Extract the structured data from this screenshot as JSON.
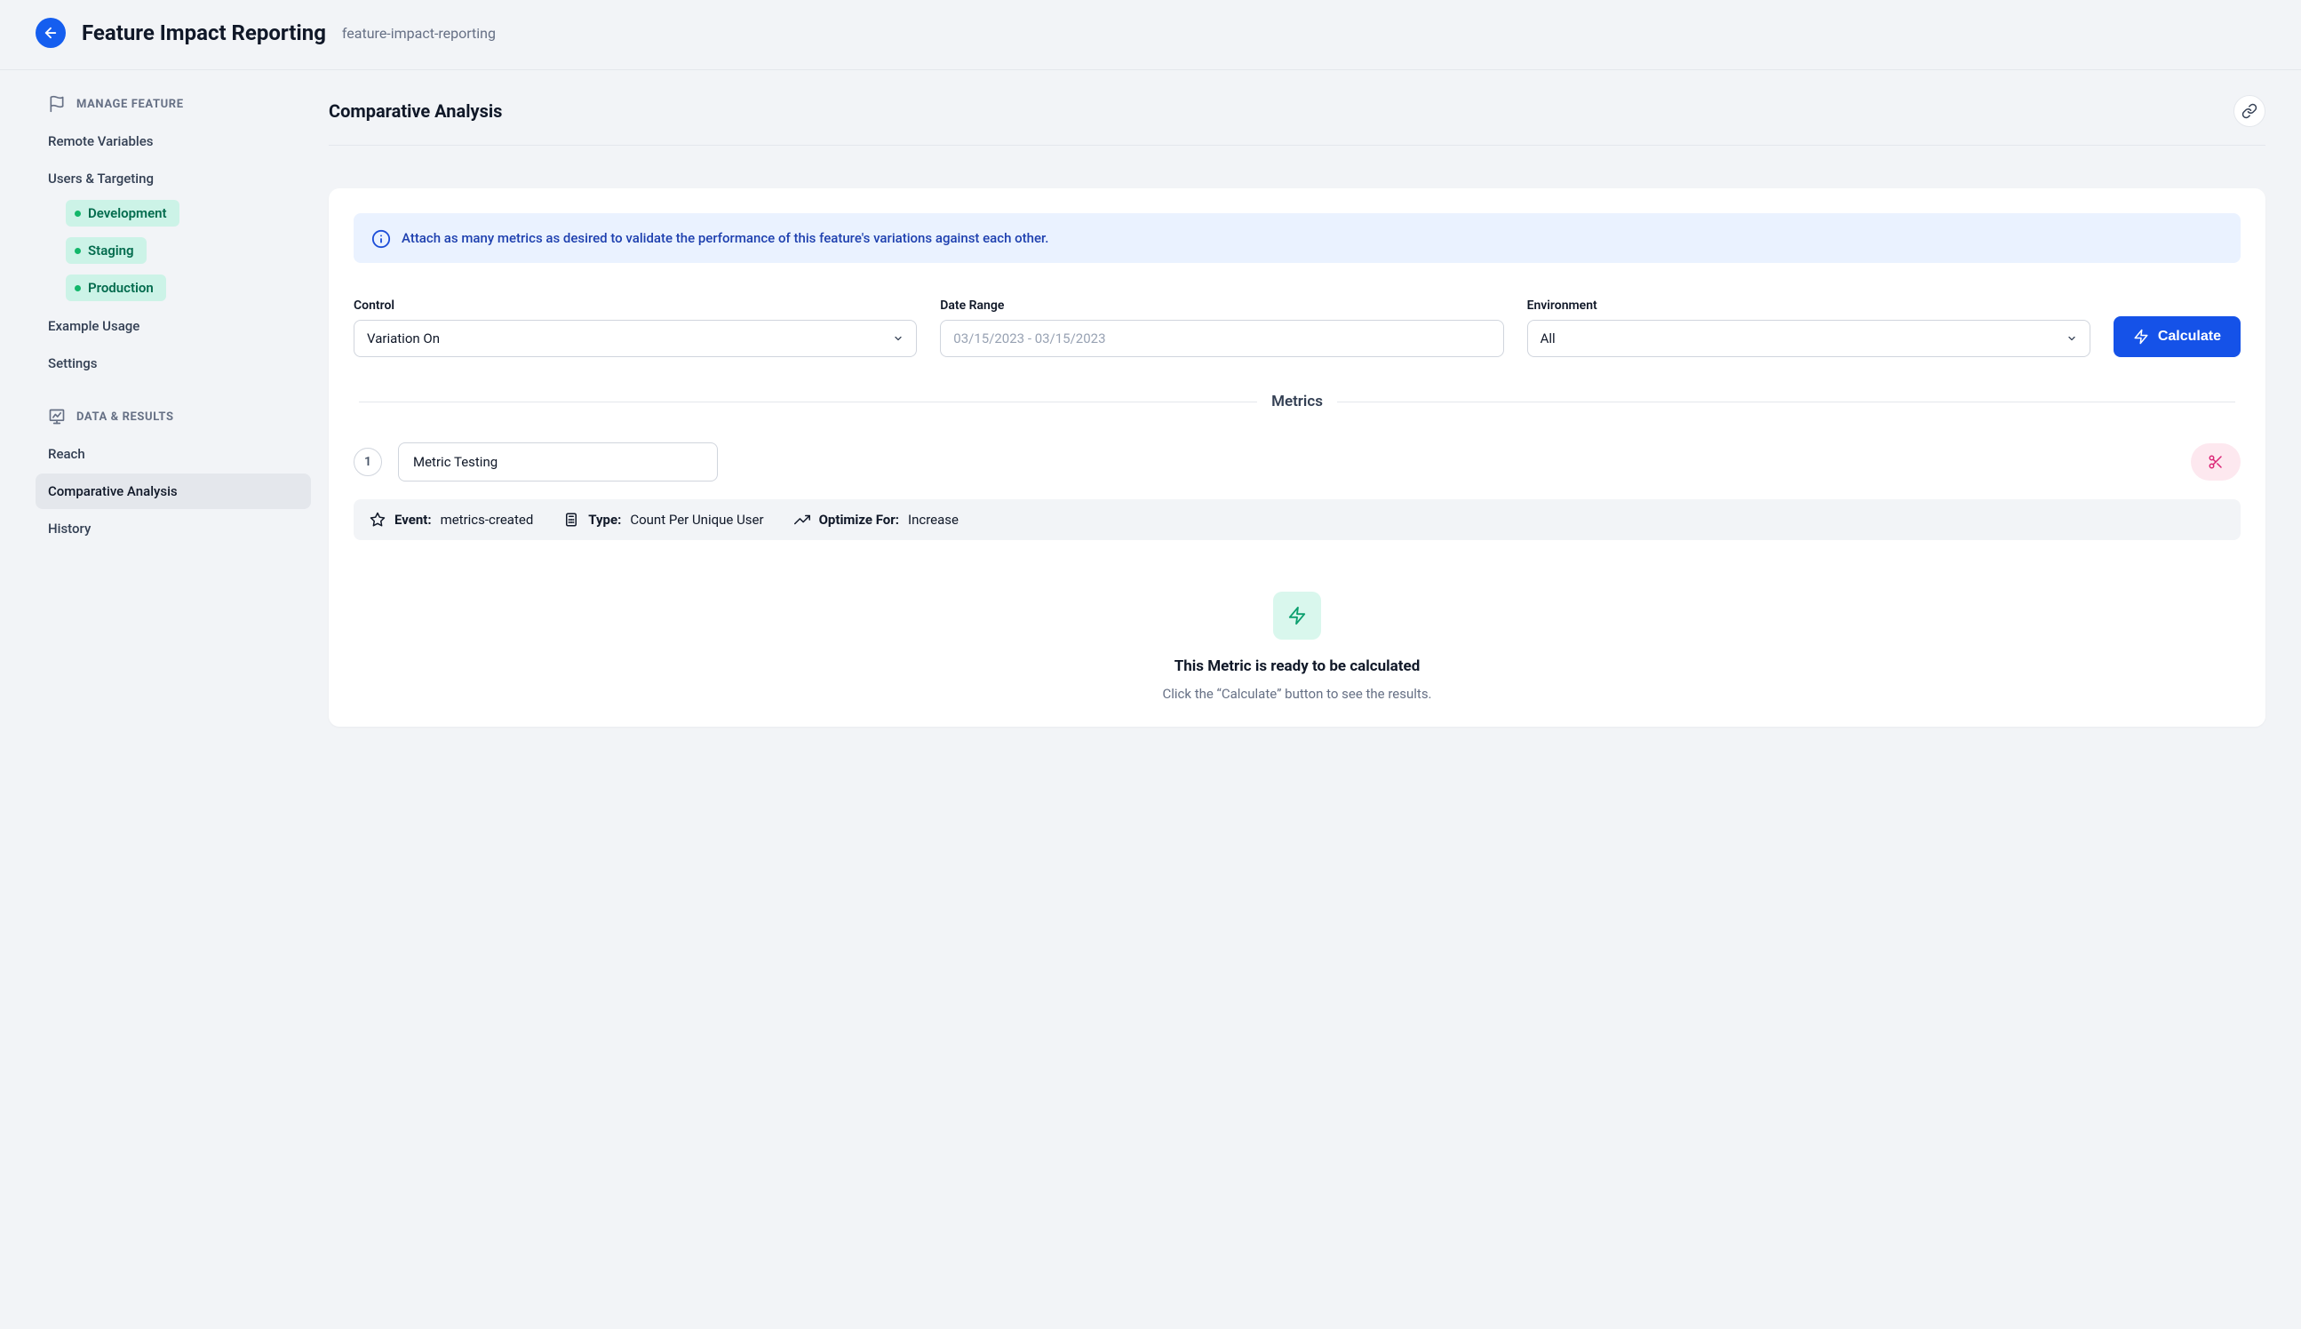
{
  "header": {
    "title": "Feature Impact Reporting",
    "slug": "feature-impact-reporting"
  },
  "sidebar": {
    "sections": [
      {
        "label": "MANAGE FEATURE",
        "items": [
          {
            "label": "Remote Variables"
          },
          {
            "label": "Users & Targeting",
            "environments": [
              "Development",
              "Staging",
              "Production"
            ]
          },
          {
            "label": "Example Usage"
          },
          {
            "label": "Settings"
          }
        ]
      },
      {
        "label": "DATA & RESULTS",
        "items": [
          {
            "label": "Reach"
          },
          {
            "label": "Comparative Analysis",
            "active": true
          },
          {
            "label": "History"
          }
        ]
      }
    ]
  },
  "main": {
    "title": "Comparative Analysis",
    "info_banner": "Attach as many metrics as desired to validate the performance of this feature's variations against each other.",
    "controls": {
      "control": {
        "label": "Control",
        "value": "Variation On"
      },
      "date_range": {
        "label": "Date Range",
        "placeholder": "03/15/2023 - 03/15/2023"
      },
      "environment": {
        "label": "Environment",
        "value": "All"
      },
      "calculate_label": "Calculate"
    },
    "metrics_header": "Metrics",
    "metric": {
      "index": "1",
      "name": "Metric Testing",
      "details": {
        "event": {
          "label": "Event:",
          "value": "metrics-created"
        },
        "type": {
          "label": "Type:",
          "value": "Count Per Unique User"
        },
        "optimize_for": {
          "label": "Optimize For:",
          "value": "Increase"
        }
      }
    },
    "ready": {
      "title": "This Metric is ready to be calculated",
      "subtitle": "Click the “Calculate” button to see the results."
    }
  }
}
